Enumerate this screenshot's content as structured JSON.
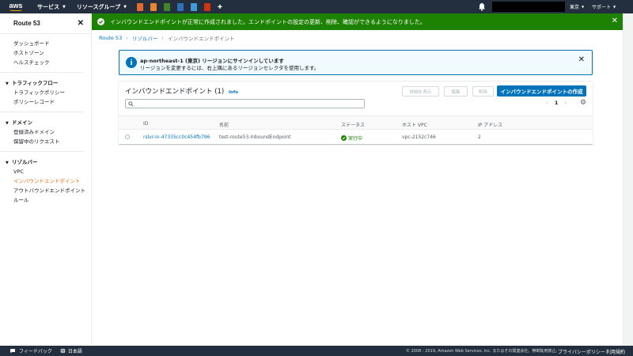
{
  "topnav": {
    "logo": "aws",
    "services_label": "サービス",
    "resource_groups_label": "リソースグループ",
    "region_label": "東京",
    "support_label": "サポート",
    "service_icons": [
      {
        "name": "orange-service-icon",
        "color": "#e7692d"
      },
      {
        "name": "orange-service-icon",
        "color": "#e8862d"
      },
      {
        "name": "green-service-icon",
        "color": "#3f8624"
      },
      {
        "name": "blue-service-icon",
        "color": "#2e73b8"
      },
      {
        "name": "blue-service-icon",
        "color": "#3f9bd8"
      },
      {
        "name": "red-service-icon",
        "color": "#d13212"
      },
      {
        "name": "plugin-icon",
        "color": "#ffffff"
      }
    ]
  },
  "sidebar": {
    "title": "Route 53",
    "top_items": [
      "ダッシュボード",
      "ホストゾーン",
      "ヘルスチェック"
    ],
    "sections": [
      {
        "title": "トラフィックフロー",
        "items": [
          "トラフィックポリシー",
          "ポリシーレコード"
        ]
      },
      {
        "title": "ドメイン",
        "items": [
          "登録済みドメイン",
          "保留中のリクエスト"
        ]
      },
      {
        "title": "リゾルバー",
        "items": [
          "VPC",
          "インバウンドエンドポイント",
          "アウトバウンドエンドポイント",
          "ルール"
        ]
      }
    ],
    "active_item": "インバウンドエンドポイント"
  },
  "flash": {
    "message": "インバウンドエンドポイントが正常に作成されました。エンドポイントの設定の更新、削除、確認ができるようになりました。",
    "color": "#1d8102"
  },
  "breadcrumb": {
    "items": [
      "Route 53",
      "リゾルバー"
    ],
    "current": "インバウンドエンドポイント"
  },
  "alert": {
    "title": "ap-northeast-1 (東京) リージョンにサインインしています",
    "body": "リージョンを変更するには、右上隅にあるリージョンセレクタを使用します。"
  },
  "panel": {
    "title": "インバウンドエンドポイント (1)",
    "info_label": "Info",
    "buttons": {
      "view_details": "詳細を表示",
      "edit": "編集",
      "delete": "削除",
      "create": "インバウンドエンドポイントの作成"
    },
    "search_placeholder": "",
    "page_number": "1",
    "columns": [
      "ID",
      "名前",
      "ステータス",
      "ホスト VPC",
      "IP アドレス"
    ],
    "rows": [
      {
        "id": "rslvr-in-47335cc0c454fb796",
        "name": "test-route53-InboundEndpoint",
        "status": "実行中",
        "vpc": "vpc-2152c746",
        "ip_count": "2"
      }
    ]
  },
  "footer": {
    "feedback": "フィードバック",
    "language": "日本語",
    "copyright": "© 2008 - 2019, Amazon Web Services, Inc. またはその関連会社。無断転用禁止。",
    "privacy": "プライバシーポリシー",
    "terms": "利用規約"
  }
}
